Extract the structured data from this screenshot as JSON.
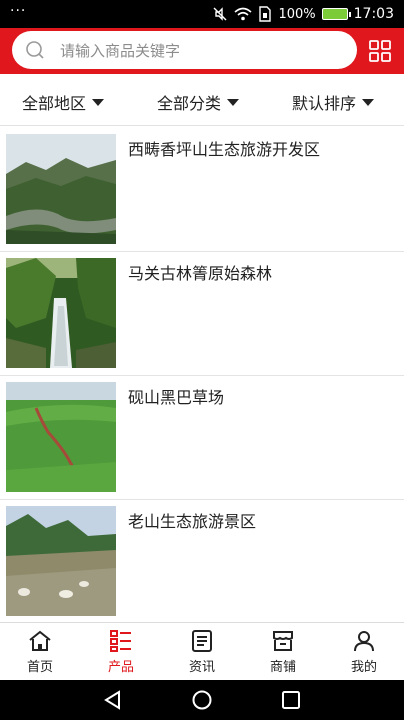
{
  "status_bar": {
    "notification_dots": "···",
    "battery_percent": "100%",
    "time": "17:03"
  },
  "search": {
    "placeholder": "请输入商品关键字"
  },
  "filters": [
    {
      "label": "全部地区"
    },
    {
      "label": "全部分类"
    },
    {
      "label": "默认排序"
    }
  ],
  "products": [
    {
      "title": "西畴香坪山生态旅游开发区"
    },
    {
      "title": "马关古林箐原始森林"
    },
    {
      "title": "砚山黑巴草场"
    },
    {
      "title": "老山生态旅游景区"
    }
  ],
  "tabbar": {
    "items": [
      {
        "label": "首页",
        "icon": "home-icon"
      },
      {
        "label": "产品",
        "icon": "product-list-icon"
      },
      {
        "label": "资讯",
        "icon": "news-icon"
      },
      {
        "label": "商铺",
        "icon": "shop-icon"
      },
      {
        "label": "我的",
        "icon": "user-icon"
      }
    ],
    "active_index": 1
  },
  "colors": {
    "brand_red": "#e0181d",
    "text": "#222222",
    "placeholder": "#8c8c8c"
  }
}
